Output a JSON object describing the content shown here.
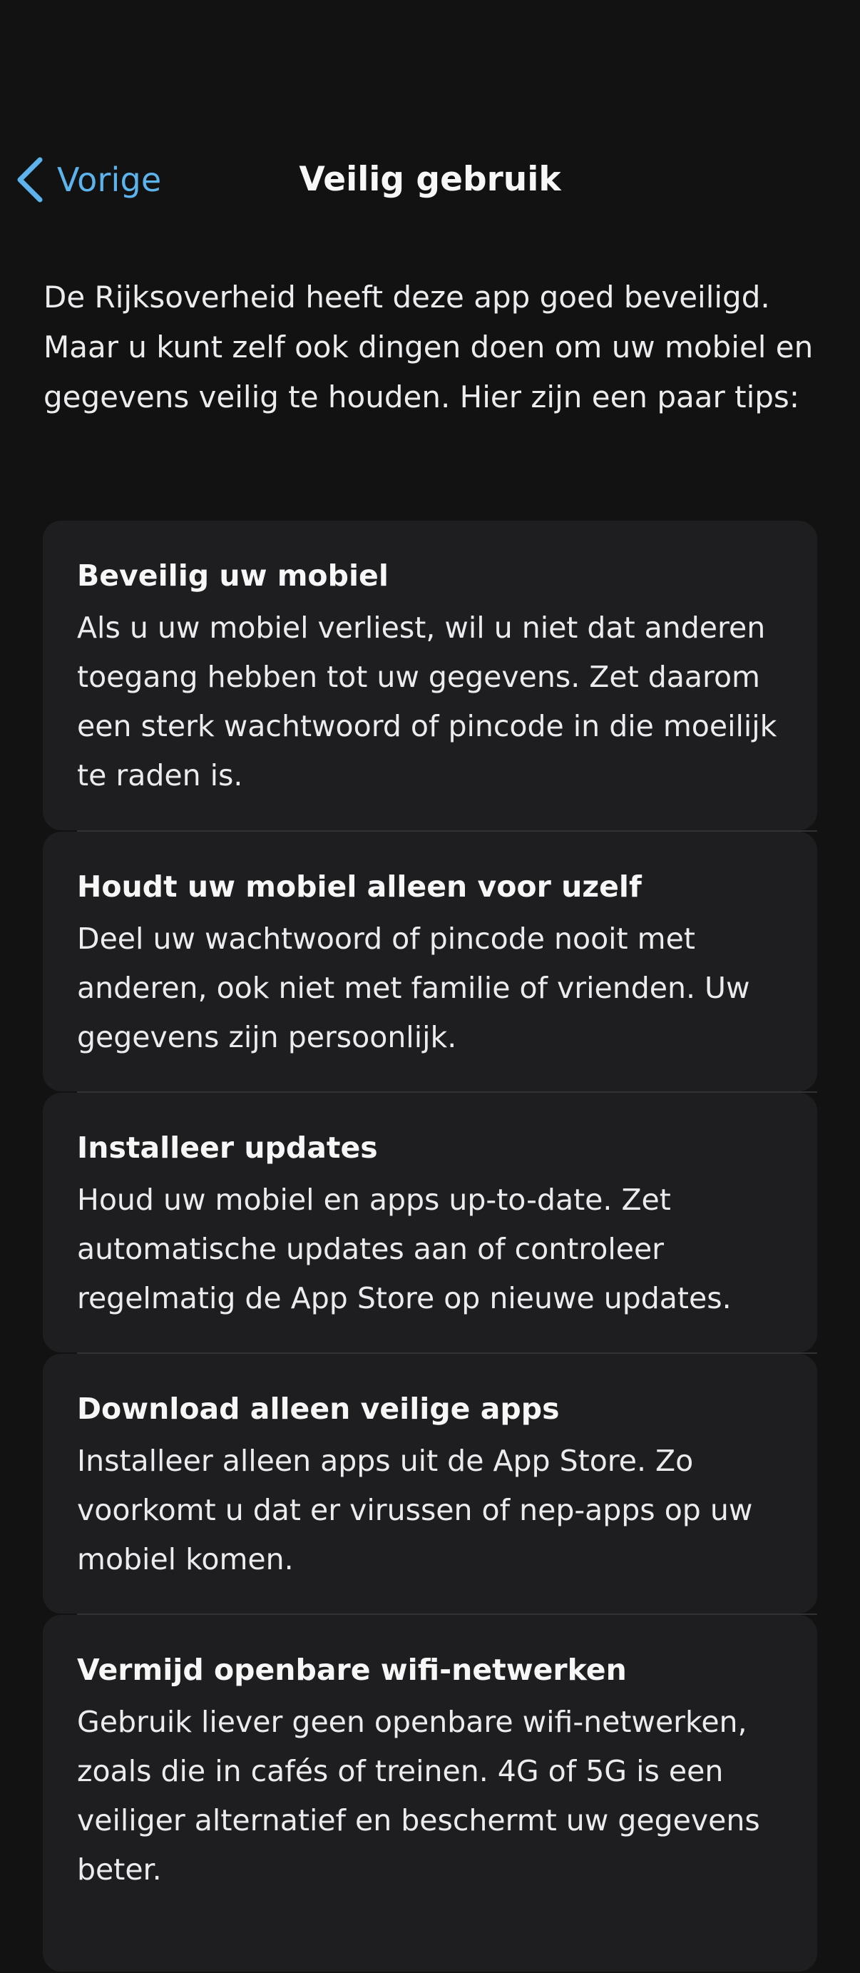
{
  "nav": {
    "back_label": "Vorige",
    "title": "Veilig gebruik"
  },
  "intro": "De Rijksoverheid heeft deze app goed beveiligd. Maar u kunt zelf ook dingen doen om uw mobiel en gegevens veilig te houden. Hier zijn een paar tips:",
  "tips": [
    {
      "title": "Beveilig uw mobiel",
      "text": "Als u uw mobiel verliest, wil u niet dat anderen toegang hebben tot uw gegevens. Zet daarom een sterk wachtwoord of pincode in die moeilijk te raden is."
    },
    {
      "title": "Houdt uw mobiel alleen voor uzelf",
      "text": "Deel uw wachtwoord of pincode nooit met anderen, ook niet met familie of vrienden. Uw gegevens zijn persoonlijk."
    },
    {
      "title": "Installeer updates",
      "text": "Houd uw mobiel en apps up-to-date. Zet automatische updates aan of controleer regelmatig de App Store op nieuwe updates."
    },
    {
      "title": "Download alleen veilige apps",
      "text": "Installeer alleen apps uit de App Store. Zo voorkomt u dat er virussen of nep-apps op uw mobiel komen."
    },
    {
      "title": "Vermijd openbare wifi-netwerken",
      "text": "Gebruik liever geen openbare wifi-netwerken, zoals die in cafés of treinen. 4G of 5G is een veiliger alternatief en beschermt uw gegevens beter."
    }
  ],
  "colors": {
    "background": "#121213",
    "card": "#1e1e20",
    "accent": "#5db3ec",
    "text": "#f4f4f6"
  },
  "icons": {
    "back": "chevron-left-icon"
  }
}
